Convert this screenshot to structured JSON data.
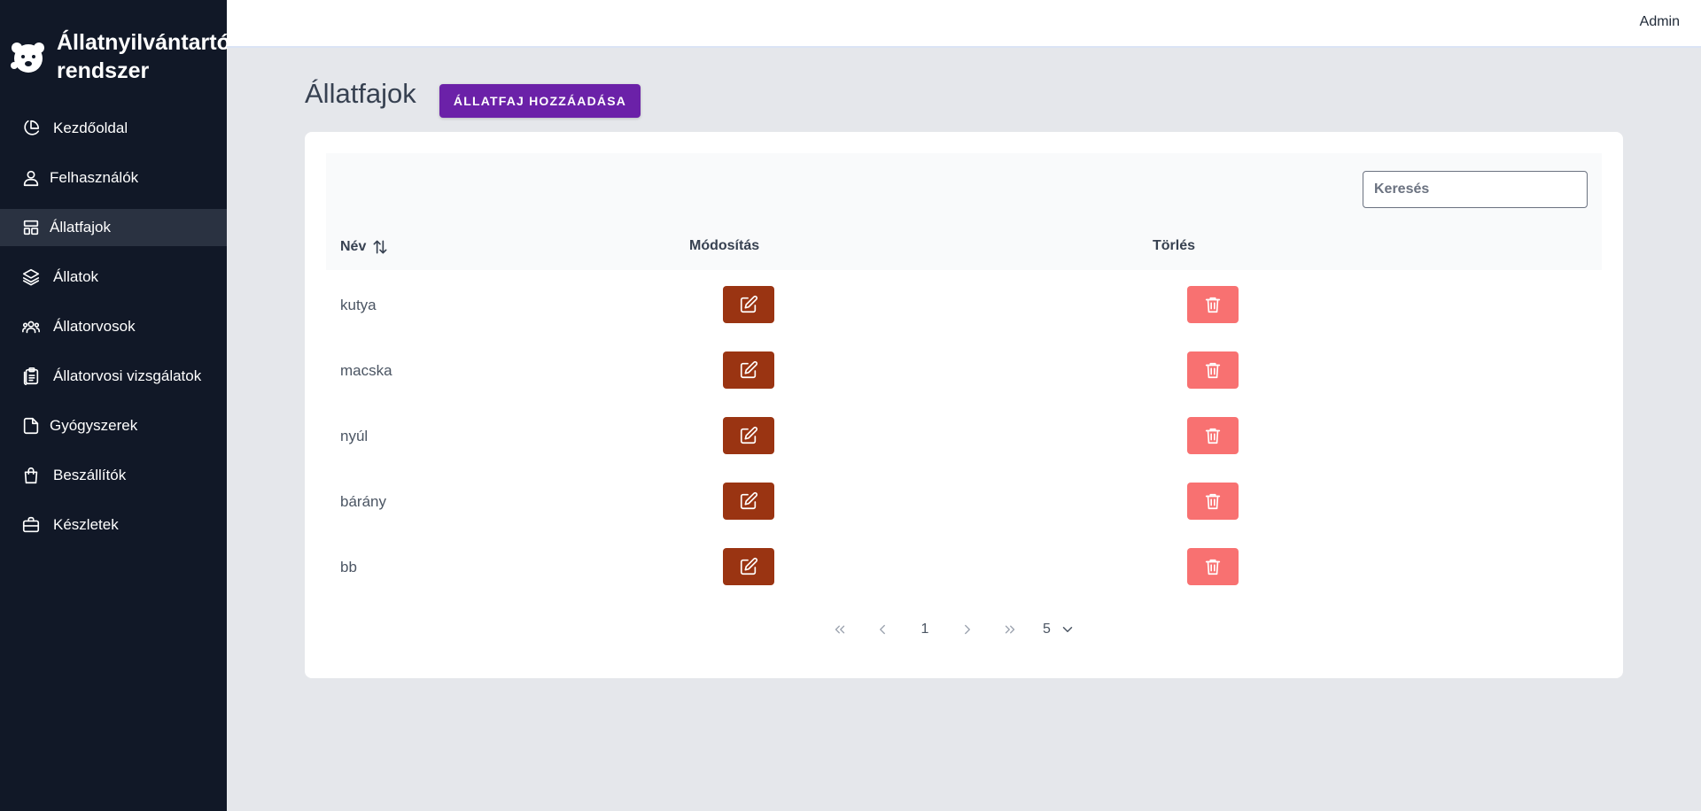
{
  "brand": {
    "title_line1": "Állatnyilvántartó",
    "title_line2": "rendszer"
  },
  "user": {
    "name": "Admin"
  },
  "nav": [
    {
      "label": "Kezdőoldal",
      "icon": "pie-chart-icon"
    },
    {
      "label": "Felhasználók",
      "icon": "user-icon"
    },
    {
      "label": "Állatfajok",
      "icon": "layout-icon",
      "active": true
    },
    {
      "label": "Állatok",
      "icon": "layers-icon"
    },
    {
      "label": "Állatorvosok",
      "icon": "users-icon"
    },
    {
      "label": "Állatorvosi vizsgálatok",
      "icon": "clipboard-icon"
    },
    {
      "label": "Gyógyszerek",
      "icon": "file-icon"
    },
    {
      "label": "Beszállítók",
      "icon": "shopping-bag-icon"
    },
    {
      "label": "Készletek",
      "icon": "briefcase-icon"
    }
  ],
  "page": {
    "title": "Állatfajok",
    "add_button": "ÁLLATFAJ HOZZÁADÁSA"
  },
  "table": {
    "search_placeholder": "Keresés",
    "columns": {
      "name": "Név",
      "edit": "Módosítás",
      "delete": "Törlés"
    },
    "rows": [
      {
        "name": "kutya"
      },
      {
        "name": "macska"
      },
      {
        "name": "nyúl"
      },
      {
        "name": "bárány"
      },
      {
        "name": "bb"
      }
    ]
  },
  "pagination": {
    "current_page": "1",
    "page_size": "5"
  },
  "colors": {
    "sidebar_bg": "#111827",
    "primary": "#6b21a8",
    "edit": "#9a3412",
    "delete": "#f87171"
  }
}
